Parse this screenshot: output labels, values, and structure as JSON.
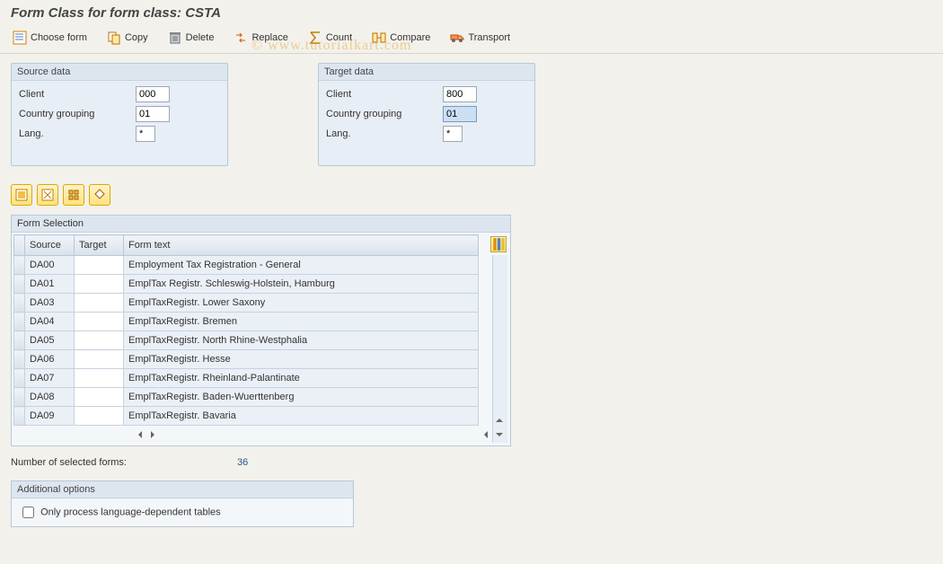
{
  "title": "Form Class for form class: CSTA",
  "toolbar": {
    "choose": "Choose form",
    "copy": "Copy",
    "delete": "Delete",
    "replace": "Replace",
    "count": "Count",
    "compare": "Compare",
    "transport": "Transport"
  },
  "watermark": "© www.tutorialkart.com",
  "source": {
    "title": "Source data",
    "client_label": "Client",
    "client": "000",
    "country_label": "Country grouping",
    "country": "01",
    "lang_label": "Lang.",
    "lang": "*"
  },
  "target": {
    "title": "Target data",
    "client_label": "Client",
    "client": "800",
    "country_label": "Country grouping",
    "country": "01",
    "lang_label": "Lang.",
    "lang": "*"
  },
  "formSelection": {
    "title": "Form Selection",
    "headers": {
      "source": "Source",
      "target": "Target",
      "text": "Form text"
    },
    "rows": [
      {
        "source": "DA00",
        "target": "",
        "text": "Employment Tax Registration - General"
      },
      {
        "source": "DA01",
        "target": "",
        "text": "EmplTax Registr. Schleswig-Holstein, Hamburg"
      },
      {
        "source": "DA03",
        "target": "",
        "text": "EmplTaxRegistr. Lower Saxony"
      },
      {
        "source": "DA04",
        "target": "",
        "text": "EmplTaxRegistr. Bremen"
      },
      {
        "source": "DA05",
        "target": "",
        "text": "EmplTaxRegistr. North Rhine-Westphalia"
      },
      {
        "source": "DA06",
        "target": "",
        "text": "EmplTaxRegistr. Hesse"
      },
      {
        "source": "DA07",
        "target": "",
        "text": "EmplTaxRegistr. Rheinland-Palantinate"
      },
      {
        "source": "DA08",
        "target": "",
        "text": "EmplTaxRegistr. Baden-Wuerttenberg"
      },
      {
        "source": "DA09",
        "target": "",
        "text": "EmplTaxRegistr. Bavaria"
      }
    ]
  },
  "count": {
    "label": "Number of selected forms:",
    "value": "36"
  },
  "options": {
    "title": "Additional options",
    "only_lang": "Only process language-dependent tables"
  }
}
